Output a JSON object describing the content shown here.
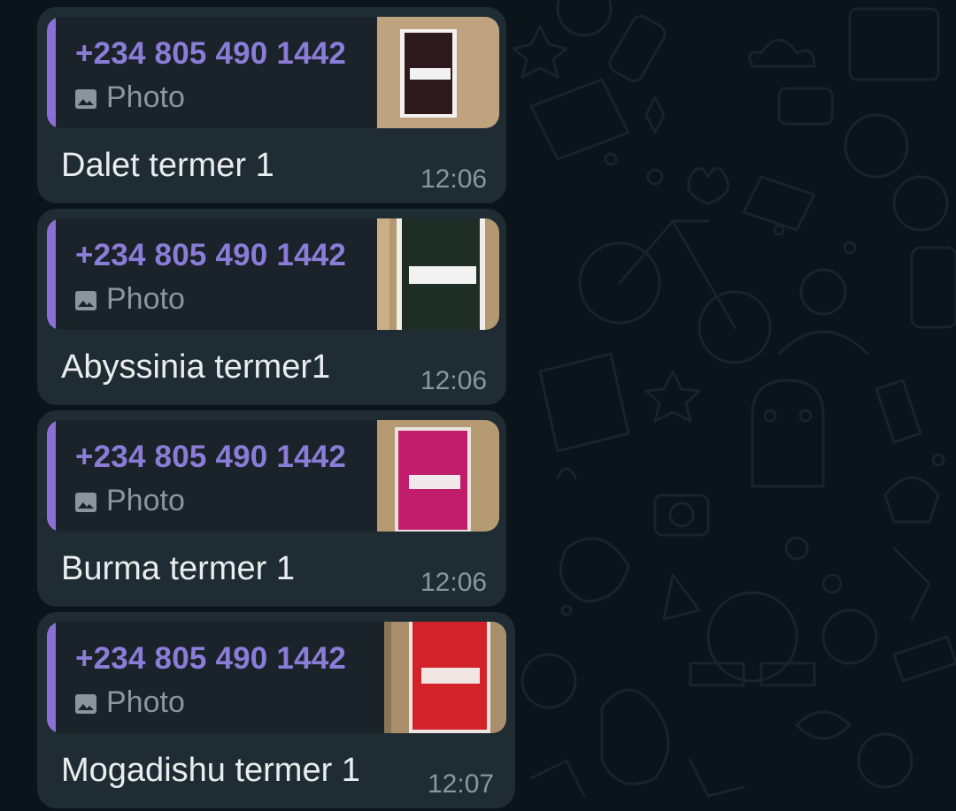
{
  "messages": [
    {
      "quote_sender": "+234 805 490 1442",
      "quote_type": "Photo",
      "photo_icon": "image-icon",
      "thumbnail_colors": {
        "background": "#bfa27f",
        "swatch": "#2e1a1c",
        "stripe": "#f2f2f2"
      },
      "caption": "Dalet termer 1",
      "time": "12:06"
    },
    {
      "quote_sender": "+234 805 490 1442",
      "quote_type": "Photo",
      "photo_icon": "image-icon",
      "thumbnail_colors": {
        "background": "#b49872",
        "swatch": "#1e2e27",
        "stripe": "#f2f2f2"
      },
      "caption": "Abyssinia termer1",
      "time": "12:06"
    },
    {
      "quote_sender": "+234 805 490 1442",
      "quote_type": "Photo",
      "photo_icon": "image-icon",
      "thumbnail_colors": {
        "background": "#b59a74",
        "swatch": "#c21d6c",
        "stripe": "#f0e8ea"
      },
      "caption": "Burma termer 1",
      "time": "12:06"
    },
    {
      "quote_sender": "+234 805 490 1442",
      "quote_type": "Photo",
      "photo_icon": "image-icon",
      "thumbnail_colors": {
        "background": "#a98f6c",
        "swatch": "#d3222a",
        "stripe": "#f2e6e4"
      },
      "caption": "Mogadishu termer 1",
      "time": "12:07"
    }
  ],
  "theme": {
    "background": "#0b141a",
    "bubble": "#202c33",
    "quote_background": "#1a2329",
    "quote_accent": "#8b6fd6",
    "sender_color": "#8b7cd8",
    "text_color": "#e9edef",
    "meta_color": "#8a969c"
  }
}
